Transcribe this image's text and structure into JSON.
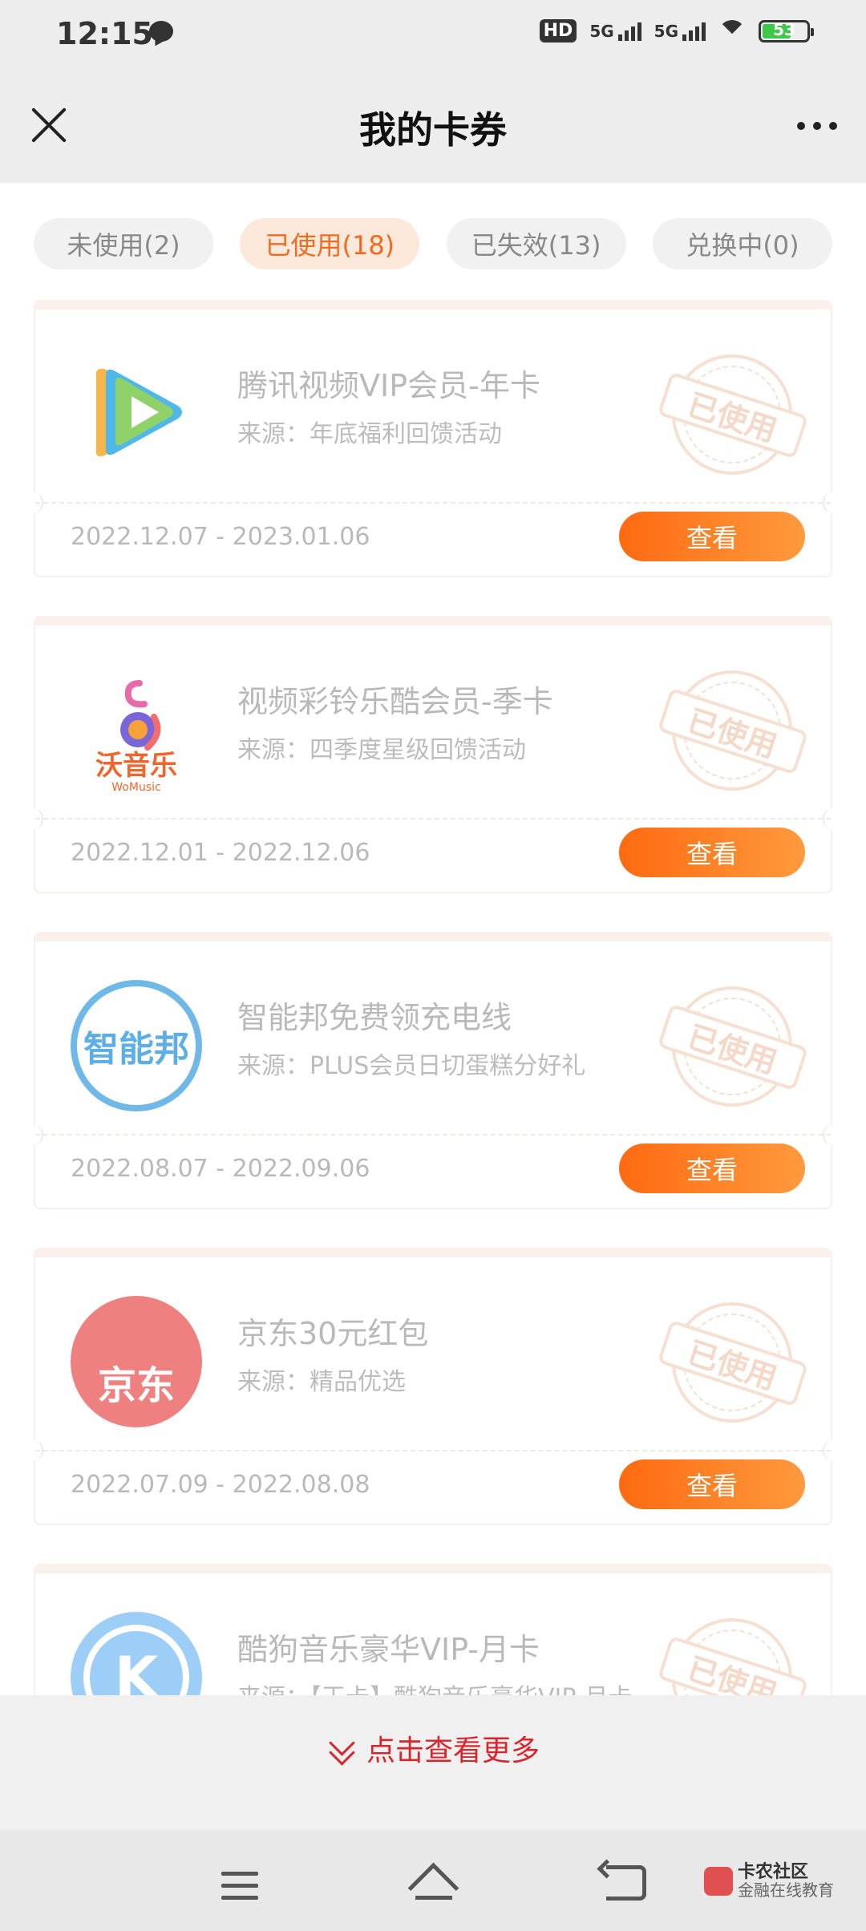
{
  "status_bar": {
    "time": "12:15",
    "hd": "HD",
    "net1": "5G",
    "net2": "5G",
    "battery": "53"
  },
  "header": {
    "title": "我的卡券"
  },
  "tabs": [
    {
      "label": "未使用(2)"
    },
    {
      "label": "已使用(18)"
    },
    {
      "label": "已失效(13)"
    },
    {
      "label": "兑换中(0)"
    }
  ],
  "active_tab": "已使用(18)",
  "stamp_label": "已使用",
  "cards": [
    {
      "logo": "tencent-video-logo",
      "title": "腾讯视频VIP会员-年卡",
      "source": "来源：年底福利回馈活动",
      "date": "2022.12.07 - 2023.01.06",
      "button": "查看"
    },
    {
      "logo": "wo-music-logo",
      "title": "视频彩铃乐酷会员-季卡",
      "source": "来源：四季度星级回馈活动",
      "date": "2022.12.01 - 2022.12.06",
      "button": "查看"
    },
    {
      "logo": "zhinengbang-logo",
      "title": "智能邦免费领充电线",
      "source": "来源：PLUS会员日切蛋糕分好礼",
      "date": "2022.08.07 - 2022.09.06",
      "button": "查看"
    },
    {
      "logo": "jd-logo",
      "title": "京东30元红包",
      "source": "来源：精品优选",
      "date": "2022.07.09 - 2022.08.08",
      "button": "查看"
    },
    {
      "logo": "kugou-logo",
      "title": "酷狗音乐豪华VIP-月卡",
      "source": "来源：【王卡】酷狗音乐豪华VIP-月卡",
      "date": "",
      "button": ""
    }
  ],
  "logos": {
    "wo_text": "沃音乐",
    "wo_sub": "WoMusic",
    "zhineng_text": "智能邦",
    "jd_text": "京东",
    "kugou_text": "K"
  },
  "see_more": "点击查看更多",
  "watermark": {
    "title": "卡农社区",
    "sub": "金融在线教育"
  },
  "colors": {
    "accent": "#ff6a10",
    "active_tab_bg": "#fde8dc",
    "see_more": "#d8262c"
  }
}
